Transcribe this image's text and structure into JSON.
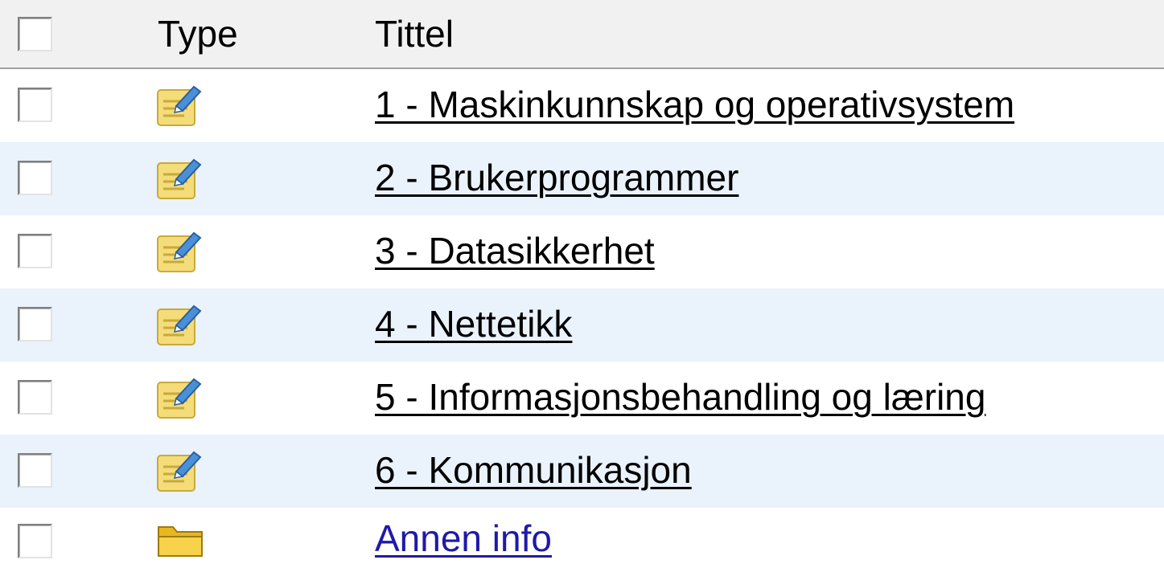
{
  "header": {
    "type_label": "Type",
    "title_label": "Tittel"
  },
  "rows": [
    {
      "type": "note",
      "icon": "notepad-pencil-icon",
      "title": "1 - Maskinkunnskap og operativsystem"
    },
    {
      "type": "note",
      "icon": "notepad-pencil-icon",
      "title": "2 - Brukerprogrammer"
    },
    {
      "type": "note",
      "icon": "notepad-pencil-icon",
      "title": "3 - Datasikkerhet"
    },
    {
      "type": "note",
      "icon": "notepad-pencil-icon",
      "title": "4 - Nettetikk"
    },
    {
      "type": "note",
      "icon": "notepad-pencil-icon",
      "title": "5 - Informasjonsbehandling og læring"
    },
    {
      "type": "note",
      "icon": "notepad-pencil-icon",
      "title": "6 - Kommunikasjon"
    },
    {
      "type": "folder",
      "icon": "folder-icon",
      "title": "Annen info"
    }
  ],
  "colors": {
    "header_bg": "#f1f1f1",
    "alt_row_bg": "#eaf2fb",
    "folder_link": "#1f1aa8"
  }
}
